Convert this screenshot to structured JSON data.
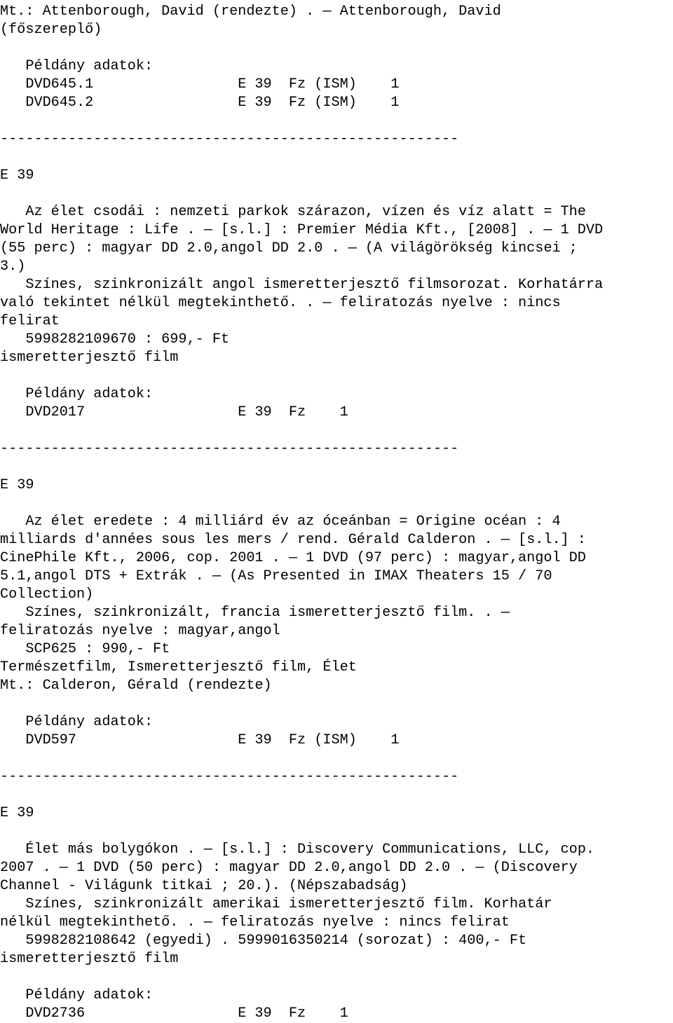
{
  "document": {
    "type": "library-catalog-printout",
    "language": "hu",
    "separator": "------------------------------------------------------",
    "blank": " ",
    "labels": {
      "copy_data": "   Példány adatok:",
      "call_number": "E 39"
    },
    "blocks": [
      {
        "kind": "continuation",
        "lines": [
          "Mt.: Attenborough, David (rendezte) . — Attenborough, David",
          "(főszereplő)"
        ]
      },
      {
        "kind": "blank",
        "lines": [
          " "
        ]
      },
      {
        "kind": "copy-data",
        "lines": [
          "   Példány adatok:",
          "   DVD645.1                 E 39  Fz (ISM)    1",
          "   DVD645.2                 E 39  Fz (ISM)    1"
        ]
      },
      {
        "kind": "blank",
        "lines": [
          " "
        ]
      },
      {
        "kind": "separator",
        "lines": [
          "------------------------------------------------------"
        ]
      },
      {
        "kind": "blank",
        "lines": [
          " "
        ]
      },
      {
        "kind": "call-number",
        "lines": [
          "E 39"
        ]
      },
      {
        "kind": "blank",
        "lines": [
          " "
        ]
      },
      {
        "kind": "bibliographic",
        "lines": [
          "   Az élet csodái : nemzeti parkok szárazon, vízen és víz alatt = The",
          "World Heritage : Life . — [s.l.] : Premier Média Kft., [2008] . — 1 DVD",
          "(55 perc) : magyar DD 2.0,angol DD 2.0 . — (A világörökség kincsei ;",
          "3.)",
          "   Színes, szinkronizált angol ismeretterjesztő filmsorozat. Korhatárra",
          "való tekintet nélkül megtekinthető. . — feliratozás nyelve : nincs",
          "felirat",
          "   5998282109670 : 699,- Ft",
          "ismeretterjesztő film"
        ]
      },
      {
        "kind": "blank",
        "lines": [
          " "
        ]
      },
      {
        "kind": "copy-data",
        "lines": [
          "   Példány adatok:",
          "   DVD2017                  E 39  Fz    1"
        ]
      },
      {
        "kind": "blank",
        "lines": [
          " "
        ]
      },
      {
        "kind": "separator",
        "lines": [
          "------------------------------------------------------"
        ]
      },
      {
        "kind": "blank",
        "lines": [
          " "
        ]
      },
      {
        "kind": "call-number",
        "lines": [
          "E 39"
        ]
      },
      {
        "kind": "blank",
        "lines": [
          " "
        ]
      },
      {
        "kind": "bibliographic",
        "lines": [
          "   Az élet eredete : 4 milliárd év az óceánban = Origine océan : 4",
          "milliards d'années sous les mers / rend. Gérald Calderon . — [s.l.] :",
          "CinePhile Kft., 2006, cop. 2001 . — 1 DVD (97 perc) : magyar,angol DD",
          "5.1,angol DTS + Extrák . — (As Presented in IMAX Theaters 15 / 70",
          "Collection)",
          "   Színes, szinkronizált, francia ismeretterjesztő film. . —",
          "feliratozás nyelve : magyar,angol",
          "   SCP625 : 990,- Ft",
          "Természetfilm, Ismeretterjesztő film, Élet",
          "Mt.: Calderon, Gérald (rendezte)"
        ]
      },
      {
        "kind": "blank",
        "lines": [
          " "
        ]
      },
      {
        "kind": "copy-data",
        "lines": [
          "   Példány adatok:",
          "   DVD597                   E 39  Fz (ISM)    1"
        ]
      },
      {
        "kind": "blank",
        "lines": [
          " "
        ]
      },
      {
        "kind": "separator",
        "lines": [
          "------------------------------------------------------"
        ]
      },
      {
        "kind": "blank",
        "lines": [
          " "
        ]
      },
      {
        "kind": "call-number",
        "lines": [
          "E 39"
        ]
      },
      {
        "kind": "blank",
        "lines": [
          " "
        ]
      },
      {
        "kind": "bibliographic",
        "lines": [
          "   Élet más bolygókon . — [s.l.] : Discovery Communications, LLC, cop.",
          "2007 . — 1 DVD (50 perc) : magyar DD 2.0,angol DD 2.0 . — (Discovery",
          "Channel - Világunk titkai ; 20.). (Népszabadság)",
          "   Színes, szinkronizált amerikai ismeretterjesztő film. Korhatár",
          "nélkül megtekinthető. . — feliratozás nyelve : nincs felirat",
          "   5998282108642 (egyedi) . 5999016350214 (sorozat) : 400,- Ft",
          "ismeretterjesztő film"
        ]
      },
      {
        "kind": "blank",
        "lines": [
          " "
        ]
      },
      {
        "kind": "copy-data",
        "lines": [
          "   Példány adatok:",
          "   DVD2736                  E 39  Fz    1"
        ]
      }
    ]
  }
}
